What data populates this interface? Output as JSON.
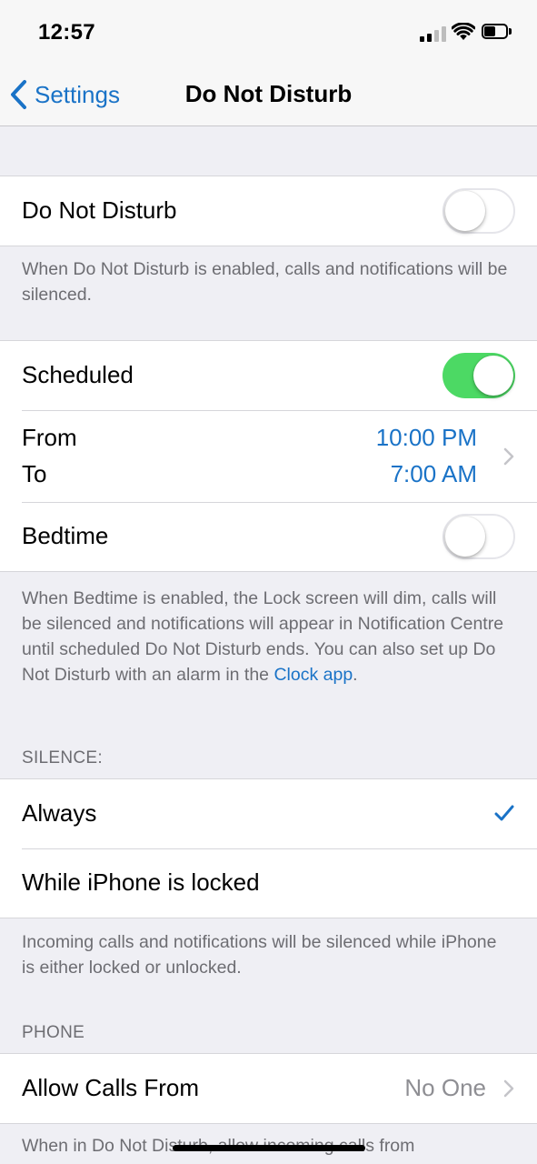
{
  "status": {
    "time": "12:57"
  },
  "nav": {
    "back_label": "Settings",
    "title": "Do Not Disturb"
  },
  "dnd": {
    "label": "Do Not Disturb",
    "enabled": false
  },
  "dnd_footer": "When Do Not Disturb is enabled, calls and notifications will be silenced.",
  "scheduled": {
    "label": "Scheduled",
    "enabled": true
  },
  "schedule": {
    "from_label": "From",
    "from_value": "10:00 PM",
    "to_label": "To",
    "to_value": "7:00 AM"
  },
  "bedtime": {
    "label": "Bedtime",
    "enabled": false
  },
  "bedtime_footer": {
    "text": "When Bedtime is enabled, the Lock screen will dim, calls will be silenced and notifications will appear in Notification Centre until scheduled Do Not Disturb ends. You can also set up Do Not Disturb with an alarm in the",
    "link": "Clock app",
    "suffix": "."
  },
  "silence": {
    "header": "SILENCE:",
    "options": [
      {
        "label": "Always",
        "selected": true
      },
      {
        "label": "While iPhone is locked",
        "selected": false
      }
    ],
    "footer": "Incoming calls and notifications will be silenced while iPhone is either locked or unlocked."
  },
  "phone": {
    "header": "PHONE",
    "allow_calls_label": "Allow Calls From",
    "allow_calls_value": "No One",
    "footer": "When in Do Not Disturb, allow incoming calls from"
  },
  "colors": {
    "accent": "#1a73c7",
    "toggle_on": "#4cd964",
    "background": "#efeff4"
  }
}
